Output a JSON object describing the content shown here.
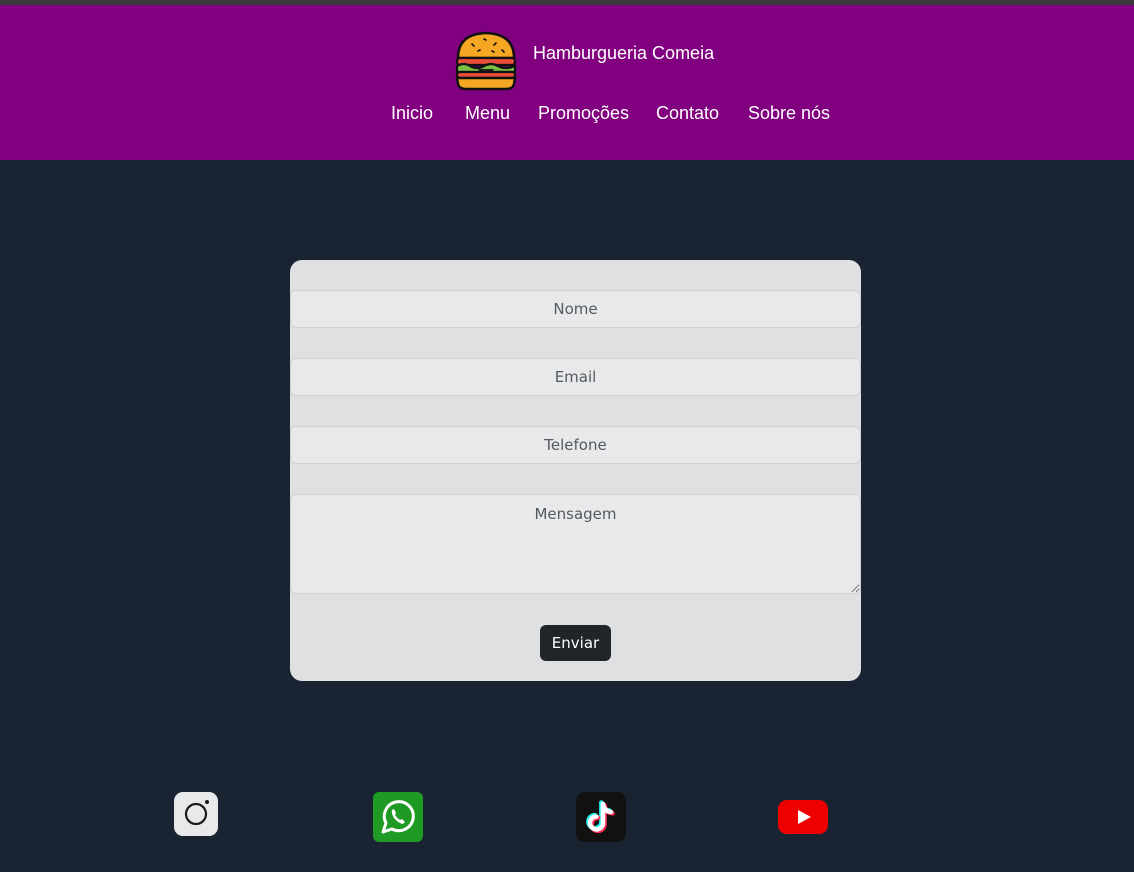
{
  "header": {
    "brand_name": "Hamburgueria Comeia",
    "logo_icon": "hamburger-icon",
    "nav": [
      {
        "label": "Inicio"
      },
      {
        "label": "Menu"
      },
      {
        "label": "Promoções"
      },
      {
        "label": "Contato"
      },
      {
        "label": "Sobre nós"
      }
    ]
  },
  "form": {
    "name_placeholder": "Nome",
    "email_placeholder": "Email",
    "phone_placeholder": "Telefone",
    "message_placeholder": "Mensagem",
    "submit_label": "Enviar"
  },
  "social": [
    {
      "icon": "instagram-icon",
      "color": "#e8e9ea"
    },
    {
      "icon": "whatsapp-icon",
      "color": "#1f9a25"
    },
    {
      "icon": "tiktok-icon",
      "color": "#111111"
    },
    {
      "icon": "youtube-icon",
      "color": "#ee0000"
    }
  ],
  "colors": {
    "header_bg": "#800080",
    "page_bg": "#1a2332",
    "card_bg": "#dfe0e2",
    "button_bg": "#212529"
  }
}
